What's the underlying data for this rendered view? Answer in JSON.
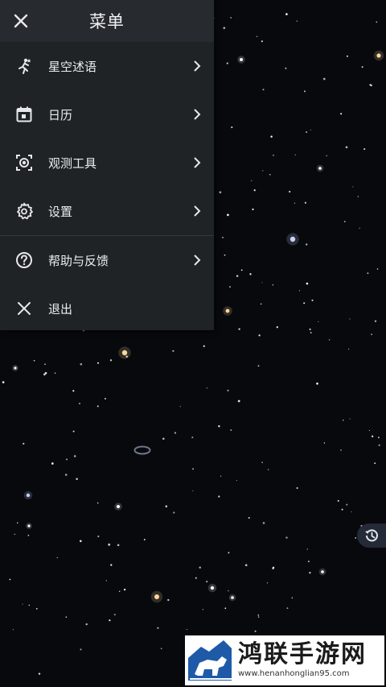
{
  "menu": {
    "title": "菜单",
    "items": [
      {
        "label": "星空述语",
        "icon": "runner-star-icon"
      },
      {
        "label": "日历",
        "icon": "calendar-icon"
      },
      {
        "label": "观测工具",
        "icon": "camera-focus-icon"
      },
      {
        "label": "设置",
        "icon": "gear-icon"
      }
    ],
    "items2": [
      {
        "label": "帮助与反馈",
        "icon": "help-circle-icon"
      },
      {
        "label": "退出",
        "icon": "close-icon"
      }
    ]
  },
  "history_button": {
    "icon": "history-icon"
  },
  "watermark": {
    "title": "鸿联手游网",
    "url": "www.henanhonglian95.com"
  },
  "colors": {
    "sky": "#07090d",
    "menu_bg": "#1f2326",
    "header_bg": "#272b2f",
    "star_warm": "#ffd79a",
    "star_cool": "#c8d4ff",
    "history_bg": "#252a38"
  }
}
